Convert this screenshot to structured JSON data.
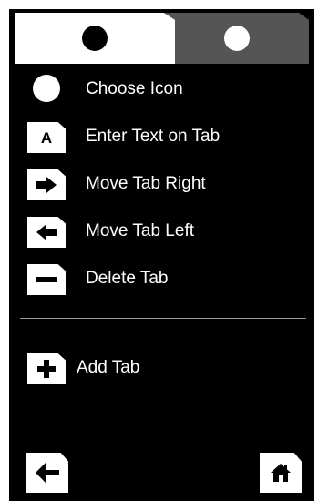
{
  "tabs": [
    {
      "icon": "circle-icon",
      "state": "selected",
      "color": "#ffffff"
    },
    {
      "icon": "circle-icon",
      "state": "unselected",
      "color": "#555555"
    }
  ],
  "menu": {
    "choose_icon_label": "Choose Icon",
    "enter_text_label": "Enter Text on Tab",
    "enter_text_icon_letter": "A",
    "move_right_label": "Move Tab Right",
    "move_left_label": "Move Tab Left",
    "delete_label": "Delete Tab",
    "add_label": "Add Tab"
  },
  "footer": {
    "back_icon": "arrow-left-icon",
    "home_icon": "home-icon"
  },
  "colors": {
    "background": "#000000",
    "foreground": "#ffffff",
    "inactive_tab": "#555555"
  }
}
